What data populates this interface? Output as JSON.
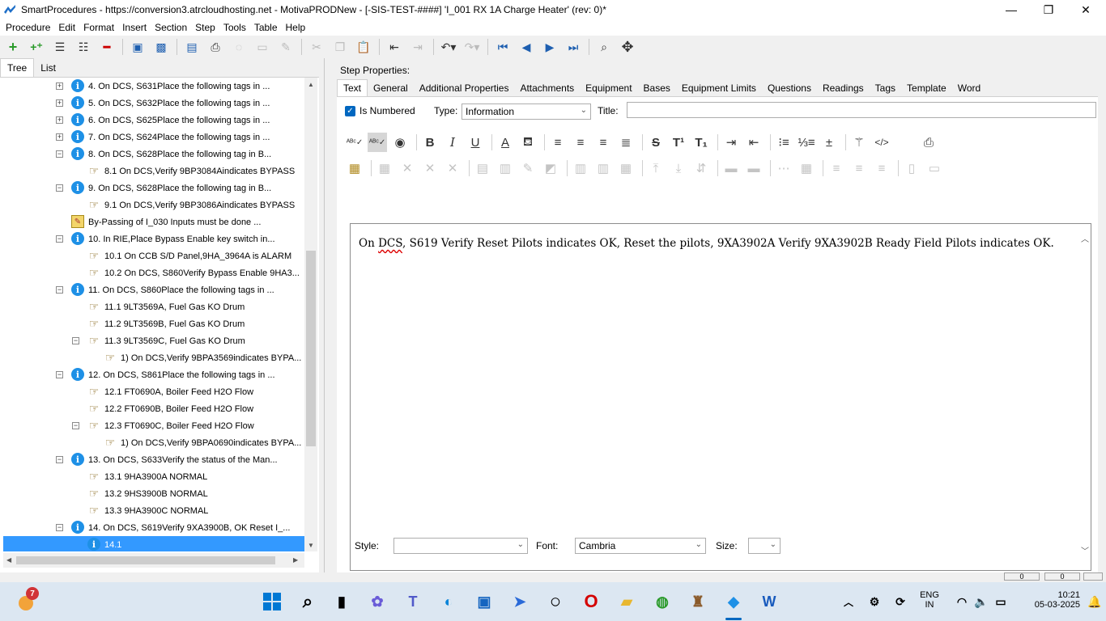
{
  "window": {
    "title": "SmartProcedures - https://conversion3.atrcloudhosting.net - MotivaPRODNew - [-SIS-TEST-####] 'I_001 RX 1A Charge Heater' (rev: 0)*",
    "minimize": "—",
    "maximize": "❐",
    "close": "✕"
  },
  "menu": [
    "Procedure",
    "Edit",
    "Format",
    "Insert",
    "Section",
    "Step",
    "Tools",
    "Table",
    "Help"
  ],
  "left_tabs": [
    "Tree",
    "List"
  ],
  "tree": [
    {
      "label": "4. On DCS, S631Place the following tags in ...",
      "icon": "info",
      "level": 0,
      "exp": "+"
    },
    {
      "label": "5. On DCS, S632Place the following tags in ...",
      "icon": "info",
      "level": 0,
      "exp": "+"
    },
    {
      "label": "6. On DCS, S625Place the following tags in ...",
      "icon": "info",
      "level": 0,
      "exp": "+"
    },
    {
      "label": "7. On DCS, S624Place the following tags in ...",
      "icon": "info",
      "level": 0,
      "exp": "+"
    },
    {
      "label": "8. On DCS, S628Place the following tag in B...",
      "icon": "info",
      "level": 0,
      "exp": "−"
    },
    {
      "label": "8.1 On DCS,Verify 9BP3084Aindicates BYPASS",
      "icon": "hand",
      "level": 1,
      "exp": ""
    },
    {
      "label": "9. On DCS, S628Place the following tag in B...",
      "icon": "info",
      "level": 0,
      "exp": "−"
    },
    {
      "label": "9.1 On DCS,Verify 9BP3086Aindicates BYPASS",
      "icon": "hand",
      "level": 1,
      "exp": ""
    },
    {
      "label": "By-Passing of I_030 Inputs must be done ...",
      "icon": "warn",
      "level": 0,
      "exp": ""
    },
    {
      "label": "10. In RIE,Place Bypass Enable key switch in...",
      "icon": "info",
      "level": 0,
      "exp": "−"
    },
    {
      "label": "10.1 On CCB S/D Panel,9HA_3964A is ALARM",
      "icon": "hand",
      "level": 1,
      "exp": ""
    },
    {
      "label": "10.2 On DCS, S860Verify Bypass Enable 9HA3...",
      "icon": "hand",
      "level": 1,
      "exp": ""
    },
    {
      "label": "11. On DCS, S860Place the following tags in ...",
      "icon": "info",
      "level": 0,
      "exp": "−"
    },
    {
      "label": "11.1 9LT3569A, Fuel Gas KO Drum",
      "icon": "hand",
      "level": 1,
      "exp": ""
    },
    {
      "label": "11.2 9LT3569B, Fuel Gas KO Drum",
      "icon": "hand",
      "level": 1,
      "exp": ""
    },
    {
      "label": "11.3 9LT3569C, Fuel Gas KO Drum",
      "icon": "hand",
      "level": 1,
      "exp": "−"
    },
    {
      "label": "1) On DCS,Verify  9BPA3569indicates  BYPA...",
      "icon": "hand",
      "level": 2,
      "exp": ""
    },
    {
      "label": "12. On DCS, S861Place the following tags in ...",
      "icon": "info",
      "level": 0,
      "exp": "−"
    },
    {
      "label": "12.1 FT0690A, Boiler Feed H2O Flow",
      "icon": "hand",
      "level": 1,
      "exp": ""
    },
    {
      "label": "12.2 FT0690B, Boiler Feed H2O Flow",
      "icon": "hand",
      "level": 1,
      "exp": ""
    },
    {
      "label": "12.3 FT0690C, Boiler Feed H2O Flow",
      "icon": "hand",
      "level": 1,
      "exp": "−"
    },
    {
      "label": "1) On DCS,Verify  9BPA0690indicates  BYPA...",
      "icon": "hand",
      "level": 2,
      "exp": ""
    },
    {
      "label": "13. On DCS, S633Verify the status of the Man...",
      "icon": "info",
      "level": 0,
      "exp": "−"
    },
    {
      "label": "13.1 9HA3900A      NORMAL",
      "icon": "hand",
      "level": 1,
      "exp": ""
    },
    {
      "label": "13.2 9HS3900B      NORMAL",
      "icon": "hand",
      "level": 1,
      "exp": ""
    },
    {
      "label": "13.3 9HA3900C      NORMAL",
      "icon": "hand",
      "level": 1,
      "exp": ""
    },
    {
      "label": "14. On DCS, S619Verify 9XA3900B, OK Reset I_...",
      "icon": "info",
      "level": 0,
      "exp": "−"
    },
    {
      "label": "14.1",
      "icon": "info",
      "level": 1,
      "exp": "",
      "selected": true
    }
  ],
  "step_properties_label": "Step Properties:",
  "right_tabs": [
    "Text",
    "General",
    "Additional Properties",
    "Attachments",
    "Equipment",
    "Bases",
    "Equipment Limits",
    "Questions",
    "Readings",
    "Tags",
    "Template",
    "Word"
  ],
  "is_numbered_label": "Is Numbered",
  "type_label": "Type:",
  "type_value": "Information",
  "title_label": "Title:",
  "title_value": "",
  "editor": {
    "prefix": "On ",
    "misspelled": "DCS",
    "text": ", S619 Verify Reset Pilots indicates OK, Reset the pilots, 9XA3902A Verify 9XA3902B Ready Field Pilots     indicates OK."
  },
  "style_label": "Style:",
  "style_value": "",
  "font_label": "Font:",
  "font_value": "Cambria",
  "size_label": "Size:",
  "size_value": "",
  "status_values": [
    "0",
    "0"
  ],
  "taskbar": {
    "badge": "7",
    "lang_top": "ENG",
    "lang_bottom": "IN",
    "time": "10:21",
    "date": "05-03-2025"
  },
  "colors": {
    "selection": "#3399ff",
    "info_icon": "#1e90e6",
    "checkbox": "#0067c0"
  }
}
